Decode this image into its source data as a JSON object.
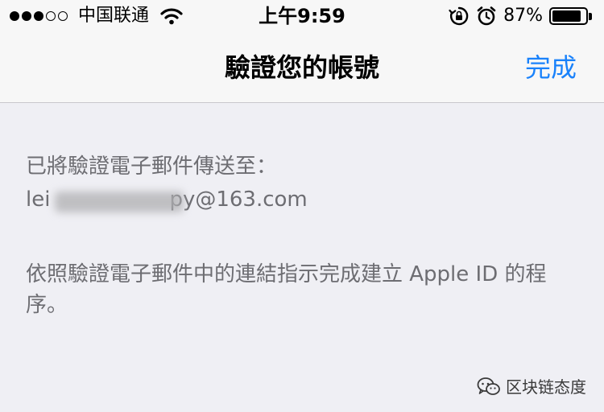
{
  "status_bar": {
    "signal_bars_full": 3,
    "signal_bars_total": 5,
    "carrier": "中国联通",
    "time": "上午9:59",
    "battery_percent": "87%",
    "battery_level": 0.87,
    "icons": [
      "wifi-icon",
      "rotation-lock-icon",
      "alarm-icon",
      "battery-icon"
    ]
  },
  "nav": {
    "title": "驗證您的帳號",
    "done_label": "完成",
    "accent_color": "#1a82fb"
  },
  "content": {
    "sent_label": "已將驗證電子郵件傳送至：",
    "email_prefix": "lei",
    "email_suffix": "py@163.com",
    "instruction": "依照驗證電子郵件中的連結指示完成建立 Apple ID 的程序。"
  },
  "watermark": {
    "text": "区块链态度",
    "icon": "wechat-icon"
  }
}
